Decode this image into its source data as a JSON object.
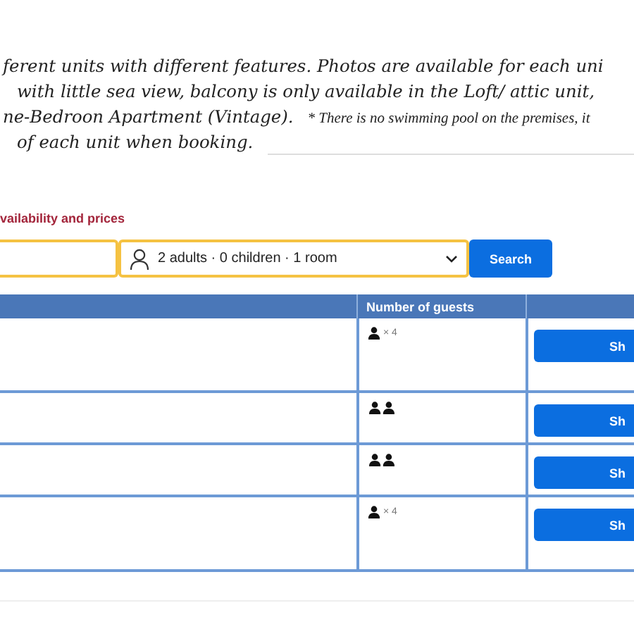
{
  "description": {
    "lines": [
      {
        "text": "ferent units with different features. Photos are available for each uni"
      },
      {
        "text": "with little sea view, balcony is only available in the Loft/ attic unit,"
      },
      {
        "text": "ne-Bedroon Apartment (Vintage).",
        "note": "* There is no swimming pool on the premises, it"
      },
      {
        "text": "of each unit when booking."
      }
    ]
  },
  "availability": {
    "heading": "vailability and prices",
    "guests_field": {
      "value": "2 adults · 0 children · 1 room"
    },
    "search_button": "Search"
  },
  "table": {
    "columns": [
      {},
      {
        "label": "Number of guests"
      },
      {}
    ],
    "rows": [
      {
        "guests": {
          "kind": "multiplier",
          "label": "× 4"
        },
        "button": "Sh"
      },
      {
        "guests": {
          "kind": "pair"
        },
        "button": "Sh"
      },
      {
        "guests": {
          "kind": "pair"
        },
        "button": "Sh"
      },
      {
        "guests": {
          "kind": "multiplier",
          "label": "× 4"
        },
        "button": "Sh"
      }
    ]
  }
}
